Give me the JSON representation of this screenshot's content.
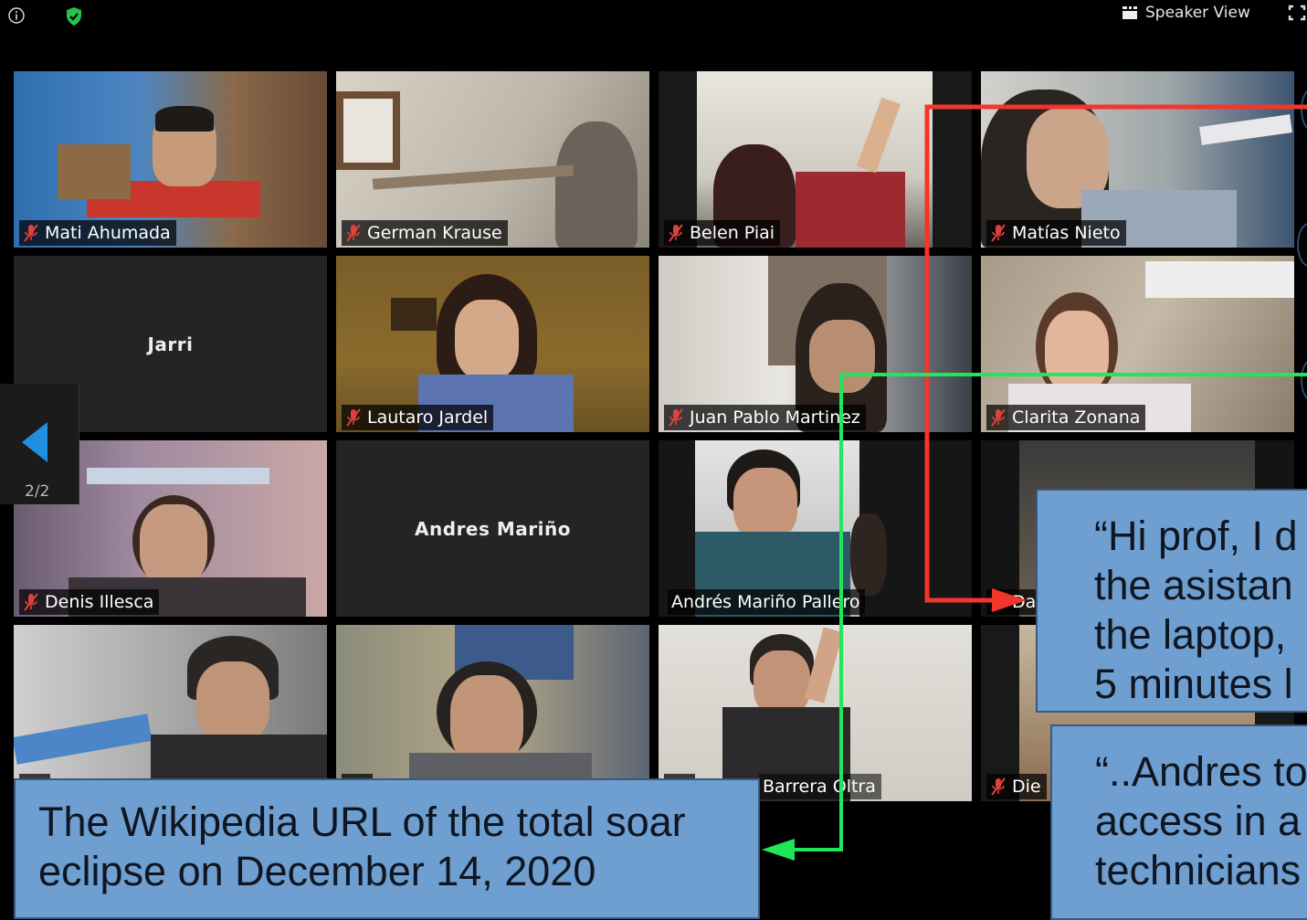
{
  "toolbar": {
    "view_label": "Speaker View",
    "icons": [
      "info-icon",
      "shield-check-icon",
      "speaker-view-icon",
      "fullscreen-icon"
    ],
    "accent_colors": {
      "secure": "#27c24c",
      "muted_mic": "#e0413a",
      "pager_arrow": "#1e8fe1"
    }
  },
  "participants": [
    {
      "name": "Mati Ahumada",
      "muted": true
    },
    {
      "name": "German Krause",
      "muted": true
    },
    {
      "name": "Belen Piai",
      "muted": true
    },
    {
      "name": "Matías Nieto",
      "muted": true
    },
    {
      "name": "Jarri",
      "video": false
    },
    {
      "name": "Lautaro Jardel",
      "muted": true
    },
    {
      "name": "Juan Pablo Martinez",
      "muted": true
    },
    {
      "name": "Clarita Zonana",
      "muted": true
    },
    {
      "name": "Denis Illesca",
      "muted": true
    },
    {
      "name": "Andres Mariño",
      "video": false
    },
    {
      "name": "Andrés Mariño Pallero",
      "muted": false
    },
    {
      "name": "",
      "muted": true
    },
    {
      "name": "",
      "muted": true
    },
    {
      "name": "",
      "muted": true
    },
    {
      "name": "Barrera Oltra",
      "muted": true
    },
    {
      "name": "Die",
      "muted": true
    },
    {
      "name": "Da",
      "muted": true
    }
  ],
  "pager": {
    "label": "2/2"
  },
  "annotations": {
    "wikipedia": {
      "line1": "The Wikipedia URL of the total soar",
      "line2": "eclipse on December 14, 2020"
    },
    "prof": {
      "line1": "“Hi prof, I d",
      "line2": "the asistan",
      "line3": "the laptop,",
      "line4": "5 minutes l"
    },
    "andres": {
      "line1": "“..Andres to",
      "line2": "access in a",
      "line3": "technicians"
    },
    "arrow_colors": {
      "red": "#f3352c",
      "green": "#21e65a"
    }
  }
}
